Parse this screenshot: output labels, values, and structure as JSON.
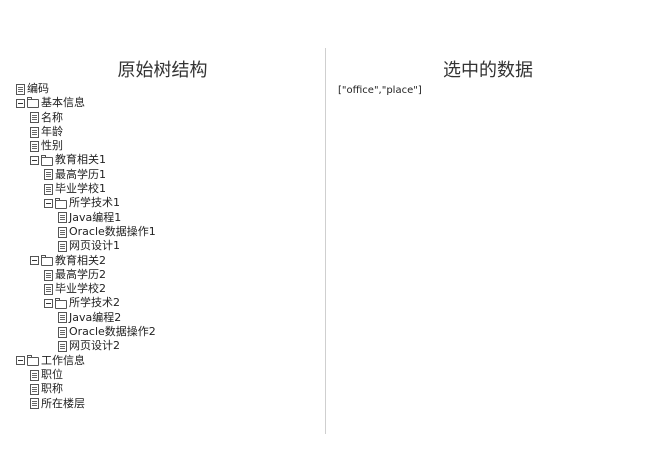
{
  "left_panel": {
    "title": "原始树结构",
    "tree": [
      {
        "label": "编码",
        "type": "file",
        "depth": 0
      },
      {
        "label": "基本信息",
        "type": "folder",
        "depth": 0
      },
      {
        "label": "名称",
        "type": "file",
        "depth": 1
      },
      {
        "label": "年龄",
        "type": "file",
        "depth": 1
      },
      {
        "label": "性别",
        "type": "file",
        "depth": 1
      },
      {
        "label": "教育相关1",
        "type": "folder",
        "depth": 1
      },
      {
        "label": "最高学历1",
        "type": "file",
        "depth": 2
      },
      {
        "label": "毕业学校1",
        "type": "file",
        "depth": 2
      },
      {
        "label": "所学技术1",
        "type": "folder",
        "depth": 2
      },
      {
        "label": "Java编程1",
        "type": "file",
        "depth": 3
      },
      {
        "label": "Oracle数据操作1",
        "type": "file",
        "depth": 3
      },
      {
        "label": "网页设计1",
        "type": "file",
        "depth": 3
      },
      {
        "label": "教育相关2",
        "type": "folder",
        "depth": 1
      },
      {
        "label": "最高学历2",
        "type": "file",
        "depth": 2
      },
      {
        "label": "毕业学校2",
        "type": "file",
        "depth": 2
      },
      {
        "label": "所学技术2",
        "type": "folder",
        "depth": 2
      },
      {
        "label": "Java编程2",
        "type": "file",
        "depth": 3
      },
      {
        "label": "Oracle数据操作2",
        "type": "file",
        "depth": 3
      },
      {
        "label": "网页设计2",
        "type": "file",
        "depth": 3
      },
      {
        "label": "工作信息",
        "type": "folder",
        "depth": 0
      },
      {
        "label": "职位",
        "type": "file",
        "depth": 1
      },
      {
        "label": "职称",
        "type": "file",
        "depth": 1
      },
      {
        "label": "所在楼层",
        "type": "file",
        "depth": 1
      }
    ]
  },
  "right_panel": {
    "title": "选中的数据",
    "selected_value": "[\"office\",\"place\"]"
  }
}
